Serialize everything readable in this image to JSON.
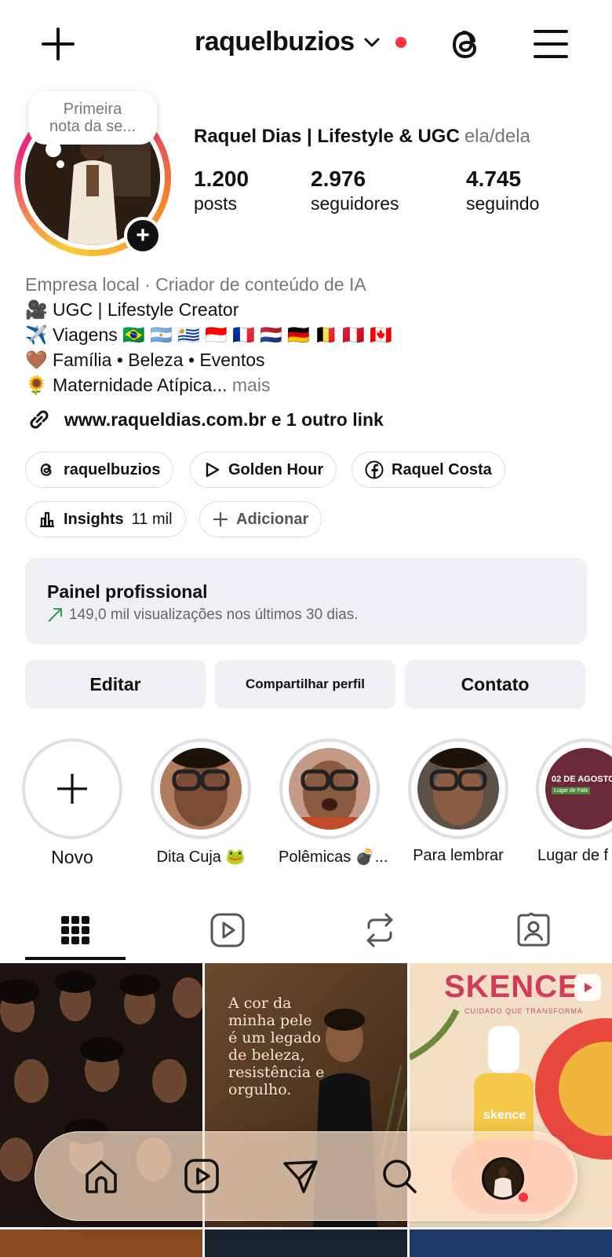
{
  "header": {
    "username": "raquelbuzios",
    "add_icon": "plus-icon",
    "threads_icon": "threads-icon",
    "menu_icon": "hamburger-menu-icon"
  },
  "note": {
    "line1": "Primeira",
    "line2": "nota da se..."
  },
  "profile": {
    "full_name": "Raquel Dias | Lifestyle & UGC",
    "pronouns": "ela/dela",
    "stats": [
      {
        "value": "1.200",
        "label": "posts"
      },
      {
        "value": "2.976",
        "label": "seguidores"
      },
      {
        "value": "4.745",
        "label": "seguindo"
      }
    ],
    "category": "Empresa local · Criador de conteúdo de IA",
    "bio": [
      "🎥 UGC | Lifestyle Creator",
      "✈️ Viagens 🇧🇷 🇦🇷 🇺🇾 🇮🇩 🇫🇷 🇳🇱 🇩🇪 🇧🇪 🇵🇪 🇨🇦",
      "🤎 Família • Beleza • Eventos",
      "🌻 Maternidade Atípica..."
    ],
    "more": "mais",
    "link": "www.raqueldias.com.br e 1 outro link"
  },
  "chips": {
    "threads": "raquelbuzios",
    "golden": "Golden Hour",
    "facebook": "Raquel Costa",
    "insights_label": "Insights",
    "insights_value": "11 mil",
    "add": "Adicionar"
  },
  "panel": {
    "title": "Painel profissional",
    "subtitle": "149,0 mil visualizações nos últimos 30 dias."
  },
  "buttons": {
    "edit": "Editar",
    "share": "Compartilhar perfil",
    "contact": "Contato"
  },
  "highlights": [
    {
      "label": "Novo"
    },
    {
      "label": "Dita Cuja 🐸"
    },
    {
      "label": "Polêmicas 💣..."
    },
    {
      "label": "Para lembrar"
    },
    {
      "label": "Lugar de f"
    }
  ],
  "highlight_card": {
    "title": "02 DE AGOSTO",
    "tag": "Lugar de Fala"
  },
  "posts": {
    "post2_text_1": "A cor da",
    "post2_text_2": "minha pele",
    "post2_text_3": "é um legado",
    "post2_text_4": "de beleza,",
    "post2_text_5": "resistência e",
    "post2_text_6": "orgulho.",
    "post3_brand": "SKENCE",
    "post3_tagline": "CUIDADO QUE TRANSFORMA",
    "post3_bottle": "skence"
  },
  "tabs": [
    "grid-icon",
    "reels-icon",
    "reposts-icon",
    "tagged-icon"
  ],
  "colors": {
    "accent_red": "#ff3040",
    "panel_bg": "#eef0f3",
    "trend_green": "#2e9e4f"
  }
}
